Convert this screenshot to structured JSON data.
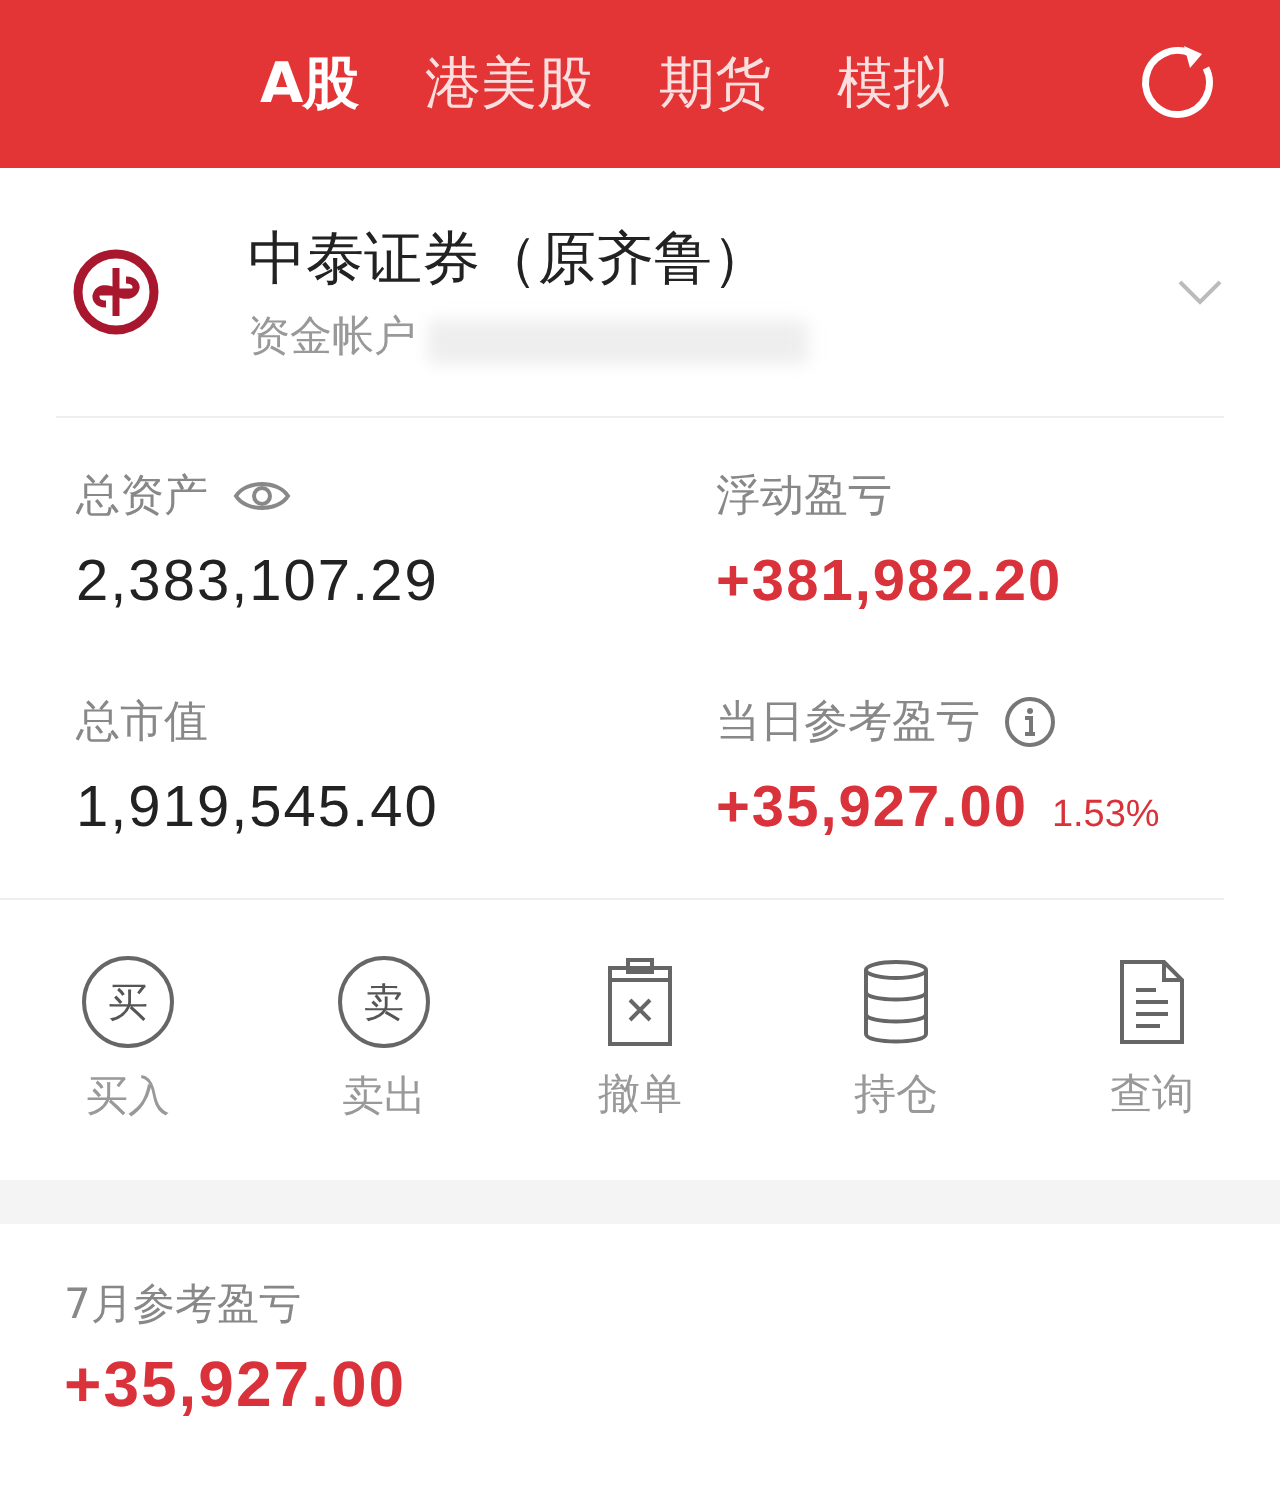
{
  "tabs": [
    {
      "label": "A股",
      "selected": true
    },
    {
      "label": "港美股",
      "selected": false
    },
    {
      "label": "期货",
      "selected": false
    },
    {
      "label": "模拟",
      "selected": false
    }
  ],
  "account": {
    "broker": "中泰证券（原齐鲁）",
    "account_label": "资金帐户",
    "expanded": false
  },
  "stats": [
    {
      "label": "总资产",
      "kind": "eye",
      "value": "2,383,107.29",
      "positive": false
    },
    {
      "label": "浮动盈亏",
      "kind": "plain",
      "value": "+381,982.20",
      "positive": true
    },
    {
      "label": "总市值",
      "kind": "plain",
      "value": "1,919,545.40",
      "positive": false
    },
    {
      "label": "当日参考盈亏",
      "kind": "info",
      "value": "+35,927.00",
      "percent": "1.53%",
      "positive": true
    }
  ],
  "actions": [
    {
      "kind": "glyph",
      "glyph": "买",
      "label": "买入"
    },
    {
      "kind": "glyph",
      "glyph": "卖",
      "label": "卖出"
    },
    {
      "kind": "clipboard",
      "label": "撤单"
    },
    {
      "kind": "database",
      "label": "持仓"
    },
    {
      "kind": "document",
      "label": "查询"
    }
  ],
  "monthly": {
    "label": "7月参考盈亏",
    "value": "+35,927.00",
    "positive": true
  }
}
